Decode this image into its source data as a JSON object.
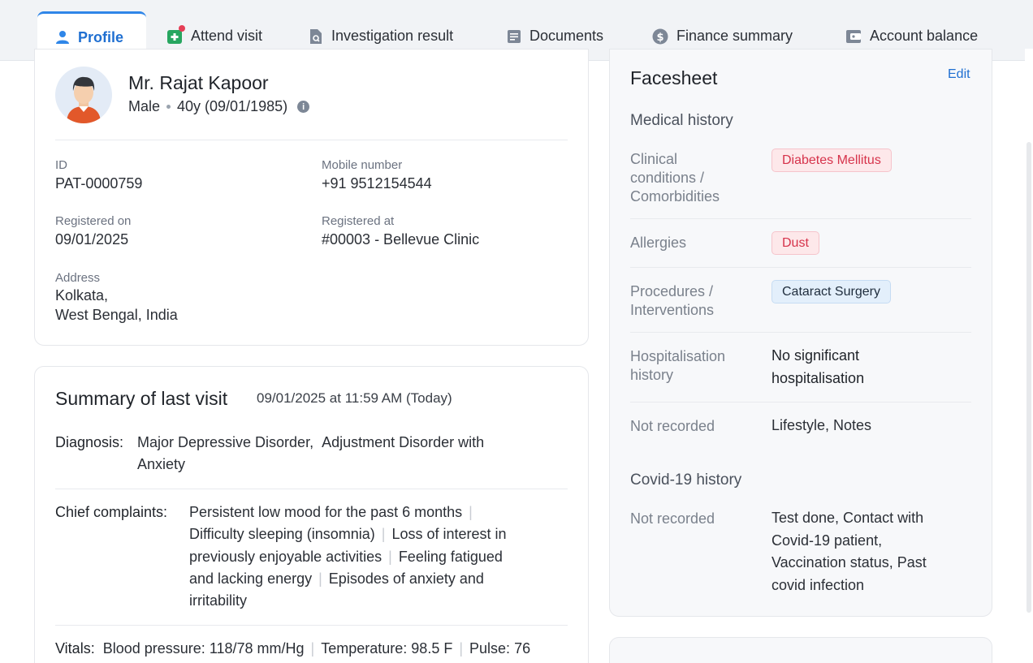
{
  "tabs": [
    {
      "label": "Profile",
      "icon": "user-icon",
      "active": true
    },
    {
      "label": "Attend visit",
      "icon": "medical-plus-icon"
    },
    {
      "label": "Investigation result",
      "icon": "document-search-icon"
    },
    {
      "label": "Documents",
      "icon": "document-icon"
    },
    {
      "label": "Finance summary",
      "icon": "dollar-icon"
    },
    {
      "label": "Account balance",
      "icon": "wallet-icon"
    }
  ],
  "patient": {
    "name": "Mr. Rajat Kapoor",
    "gender": "Male",
    "age_dob": "40y (09/01/1985)",
    "fields": {
      "id_label": "ID",
      "id_value": "PAT-0000759",
      "mobile_label": "Mobile number",
      "mobile_value": "+91 9512154544",
      "reg_on_label": "Registered on",
      "reg_on_value": "09/01/2025",
      "reg_at_label": "Registered at",
      "reg_at_value": "#00003 - Bellevue Clinic",
      "address_label": "Address",
      "address_line1": "Kolkata,",
      "address_line2": "West Bengal, India"
    }
  },
  "visit": {
    "title": "Summary of last visit",
    "datetime": "09/01/2025 at 11:59 AM (Today)",
    "diagnosis_label": "Diagnosis:",
    "diagnosis": [
      "Major Depressive Disorder,",
      "Adjustment Disorder with",
      "Anxiety"
    ],
    "complaints_label": "Chief complaints:",
    "complaints": [
      "Persistent low mood for the past 6 months",
      "Difficulty sleeping (insomnia)",
      "Loss of interest in",
      "previously enjoyable activities",
      "Feeling fatigued",
      "and lacking energy",
      "Episodes of anxiety and",
      "irritability"
    ],
    "vitals_label": "Vitals:",
    "vitals": [
      {
        "name": "Blood pressure:",
        "value": "118/78 mm/Hg"
      },
      {
        "name": "Temperature:",
        "value": "98.5 F"
      },
      {
        "name": "Pulse:",
        "value": "76"
      }
    ]
  },
  "facesheet": {
    "title": "Facesheet",
    "edit": "Edit",
    "medical_history": "Medical history",
    "clinical_label": [
      "Clinical",
      "conditions /",
      "Comorbidities"
    ],
    "clinical_chip": "Diabetes Mellitus",
    "allergies_label": "Allergies",
    "allergies_chip": "Dust",
    "procedures_label": [
      "Procedures /",
      "Interventions"
    ],
    "procedures_chip": "Cataract Surgery",
    "hosp_label": [
      "Hospitalisation",
      "history"
    ],
    "hosp_value": [
      "No significant",
      "hospitalisation"
    ],
    "not_recorded_label": "Not recorded",
    "not_recorded_value": "Lifestyle, Notes",
    "covid_title": "Covid-19 history",
    "covid_label": "Not recorded",
    "covid_value": [
      "Test done, Contact with",
      "Covid-19 patient,",
      "Vaccination status, Past",
      "covid infection"
    ]
  },
  "colors": {
    "accent": "#1f6fd1",
    "chip_red": "#d6334b",
    "chip_blue_bg": "#e3effb"
  }
}
